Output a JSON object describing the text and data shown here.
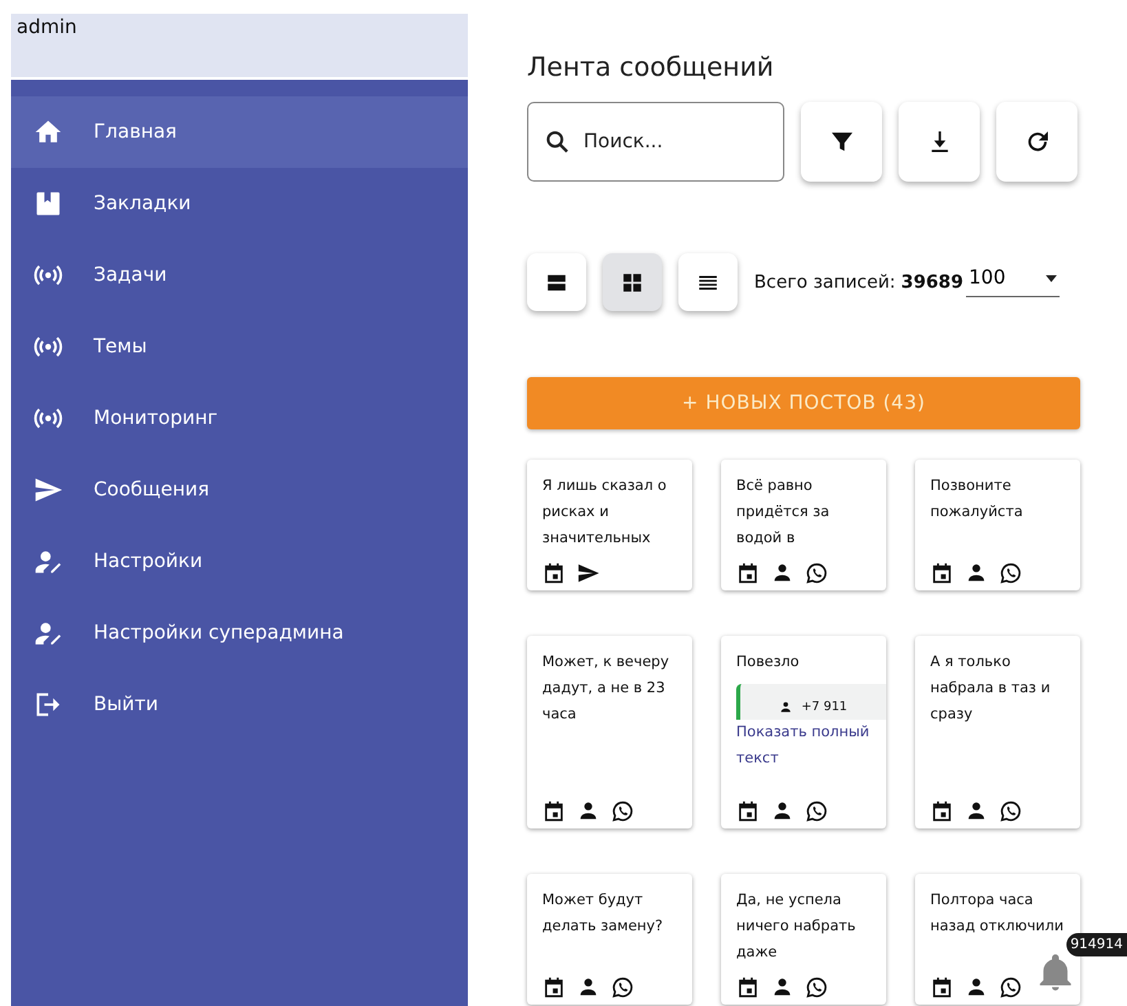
{
  "user": {
    "name": "admin"
  },
  "sidebar": {
    "items": [
      {
        "label": "Главная",
        "kind": "home",
        "selected": true
      },
      {
        "label": "Закладки",
        "kind": "bookmark",
        "selected": false
      },
      {
        "label": "Задачи",
        "kind": "broadcast",
        "selected": false
      },
      {
        "label": "Темы",
        "kind": "broadcast",
        "selected": false
      },
      {
        "label": "Мониторинг",
        "kind": "broadcast",
        "selected": false
      },
      {
        "label": "Сообщения",
        "kind": "send",
        "selected": false
      },
      {
        "label": "Настройки",
        "kind": "useredit",
        "selected": false
      },
      {
        "label": "Настройки суперадмина",
        "kind": "useredit",
        "selected": false
      },
      {
        "label": "Выйти",
        "kind": "logout",
        "selected": false
      }
    ]
  },
  "page": {
    "title": "Лента сообщений"
  },
  "search": {
    "placeholder": "Поиск..."
  },
  "toolbar": {
    "buttons": [
      {
        "kind": "filter"
      },
      {
        "kind": "download"
      },
      {
        "kind": "refresh"
      }
    ]
  },
  "view_modes": [
    {
      "kind": "rows",
      "selected": false
    },
    {
      "kind": "grid",
      "selected": true
    },
    {
      "kind": "list",
      "selected": false
    }
  ],
  "total": {
    "label": "Всего записей:",
    "value": "39689"
  },
  "page_size": {
    "value": "100"
  },
  "new_posts_button": {
    "label": "+ НОВЫХ ПОСТОВ (43)"
  },
  "posts": [
    {
      "text": "Я лишь сказал о рисках и значительных",
      "kind": "telegram"
    },
    {
      "text": "Всё равно придётся за водой в",
      "kind": "whatsapp"
    },
    {
      "text": "Позвоните пожалуйста",
      "kind": "whatsapp"
    },
    {
      "text": "Может, к вечеру дадут, а не в 23 часа",
      "kind": "whatsapp"
    },
    {
      "text": "Повезло",
      "quote": {
        "author": "+7 911"
      },
      "link": "Показать полный текст",
      "kind": "whatsapp"
    },
    {
      "text": "А я только набрала в таз и сразу",
      "kind": "whatsapp"
    },
    {
      "text": "Может будут делать замену?",
      "kind": "whatsapp"
    },
    {
      "text": "Да, не успела ничего набрать даже",
      "kind": "whatsapp"
    },
    {
      "text": "Полтора часа назад отключили",
      "kind": "whatsapp"
    }
  ],
  "notifications": {
    "count": "914914"
  }
}
